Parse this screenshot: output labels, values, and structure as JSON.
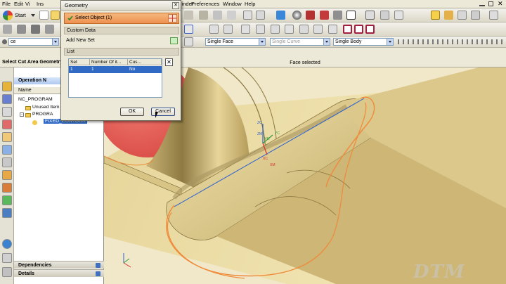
{
  "menu": {
    "items": [
      "File",
      "Edit",
      "Vi",
      "Ins",
      "Finder",
      "Preferences",
      "Window",
      "Help"
    ],
    "start_label": "Start"
  },
  "toolbar": {
    "combo_left": "ce",
    "face_filter": "Single Face",
    "curve_filter": "Single Curve",
    "body_filter": "Single Body"
  },
  "status": {
    "prompt": "Select Cut Area Geometry",
    "message": "Face selected"
  },
  "navigator": {
    "title": "Operation N",
    "column_name": "Name",
    "items": [
      "NC_PROGRAM",
      "Unused Item",
      "PROGRA",
      "FIXED_CONTOUR"
    ],
    "sections": [
      "Dependencies",
      "Details"
    ]
  },
  "dialog": {
    "title": "Geometry",
    "select_object": "Select Object (1)",
    "custom_data": "Custom Data",
    "add_new_set": "Add New Set",
    "list_label": "List",
    "columns": [
      "Set",
      "Number Of it...",
      "Cus..."
    ],
    "row": [
      "1",
      "1",
      "No"
    ],
    "ok_label": "OK",
    "cancel_label": "Cancel"
  },
  "axes": {
    "zc": "ZC",
    "yc": "YC",
    "xc": "XC",
    "zm": "ZM",
    "ym": "YM",
    "xm": "XM"
  },
  "colors": {
    "part": "#d9c98e",
    "highlight": "#ef8a3a",
    "fixture": "#e8605a",
    "selection_bar": "#ee9150",
    "axis_blue": "#2a5fd0"
  },
  "watermark": "DTM"
}
